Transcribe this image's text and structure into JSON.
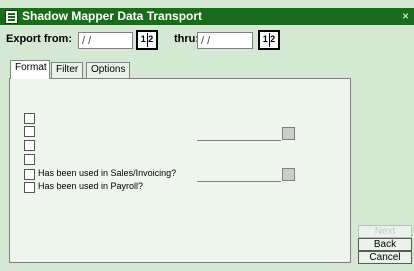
{
  "window": {
    "title": "Shadow Mapper Data Transport",
    "close_symbol": "×"
  },
  "toolbar": {
    "export_from_label": "Export from:",
    "export_from_value": "/ /",
    "thru_label": "thru:",
    "thru_value": "/ /",
    "calendar_glyph": "1 2"
  },
  "tabs": [
    {
      "label": "Format",
      "active": true
    },
    {
      "label": "Filter",
      "active": false
    },
    {
      "label": "Options",
      "active": false
    }
  ],
  "panel": {
    "checkboxes": [
      {
        "label": ""
      },
      {
        "label": ""
      },
      {
        "label": ""
      },
      {
        "label": ""
      },
      {
        "label": "Has been used in Sales/Invoicing?"
      },
      {
        "label": "Has been used in Payroll?"
      }
    ]
  },
  "buttons": {
    "next": "Next",
    "back": "Back",
    "cancel": "Cancel"
  },
  "colors": {
    "titlebar": "#1b6b1d",
    "window_bg": "#d4e8d4"
  }
}
